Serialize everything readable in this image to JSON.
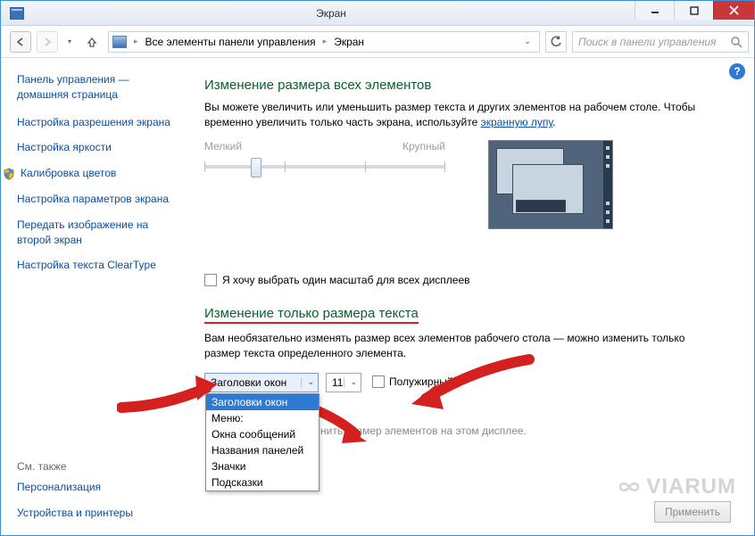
{
  "window": {
    "title": "Экран"
  },
  "breadcrumb": {
    "root": "Все элементы панели управления",
    "leaf": "Экран"
  },
  "search": {
    "placeholder": "Поиск в панели управления"
  },
  "sidebar": {
    "home": "Панель управления — домашняя страница",
    "links": [
      "Настройка разрешения экрана",
      "Настройка яркости",
      "Калибровка цветов",
      "Настройка параметров экрана",
      "Передать изображение на второй экран",
      "Настройка текста ClearType"
    ],
    "seealso_label": "См. также",
    "seealso": [
      "Персонализация",
      "Устройства и принтеры"
    ]
  },
  "main": {
    "h1": "Изменение размера всех элементов",
    "desc_a": "Вы можете увеличить или уменьшить размер текста и других элементов на рабочем столе. Чтобы временно увеличить только часть экрана, используйте ",
    "desc_link": "экранную лупу",
    "desc_b": ".",
    "slider_min": "Мелкий",
    "slider_max": "Крупный",
    "chk_scale": "Я хочу выбрать один масштаб для всех дисплеев",
    "h2": "Изменение только размера текста",
    "desc2": "Вам необязательно изменять размер всех элементов рабочего стола — можно изменить только размер текста определенного элемента.",
    "select_value": "Заголовки окон",
    "select_options": [
      "Заголовки окон",
      "Меню:",
      "Окна сообщений",
      "Названия панелей",
      "Значки",
      "Подсказки"
    ],
    "font_size": "11",
    "bold_label": "Полужирный",
    "notice": "нить размер элементов на этом дисплее.",
    "apply": "Применить"
  },
  "watermark": "VIARUM"
}
